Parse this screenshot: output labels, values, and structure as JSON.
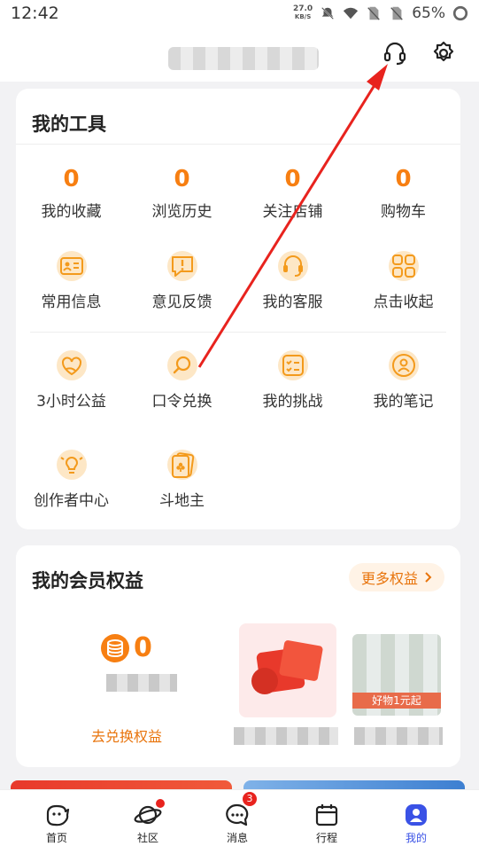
{
  "status_bar": {
    "time": "12:42",
    "net_speed_value": "27.0",
    "net_speed_unit": "KB/S",
    "battery": "65%"
  },
  "header": {
    "icons": [
      "headset-icon",
      "settings-gear-icon"
    ]
  },
  "tools": {
    "title": "我的工具",
    "stats": [
      {
        "value": "0",
        "label": "我的收藏"
      },
      {
        "value": "0",
        "label": "浏览历史"
      },
      {
        "value": "0",
        "label": "关注店铺"
      },
      {
        "value": "0",
        "label": "购物车"
      }
    ],
    "items": [
      {
        "label": "常用信息",
        "icon": "id-card-icon"
      },
      {
        "label": "意见反馈",
        "icon": "feedback-icon"
      },
      {
        "label": "我的客服",
        "icon": "customer-service-icon"
      },
      {
        "label": "点击收起",
        "icon": "grid-icon"
      },
      {
        "label": "3小时公益",
        "icon": "charity-heart-icon"
      },
      {
        "label": "口令兑换",
        "icon": "search-key-icon"
      },
      {
        "label": "我的挑战",
        "icon": "checklist-icon"
      },
      {
        "label": "我的笔记",
        "icon": "user-note-icon"
      },
      {
        "label": "创作者中心",
        "icon": "lightbulb-icon"
      },
      {
        "label": "斗地主",
        "icon": "playing-cards-icon"
      }
    ]
  },
  "member": {
    "title": "我的会员权益",
    "more_label": "更多权益",
    "coin_value": "0",
    "exchange_label": "去兑换权益",
    "promo_badge": "好物1元起"
  },
  "tabs": [
    {
      "label": "首页",
      "icon": "home-pig-icon"
    },
    {
      "label": "社区",
      "icon": "planet-icon"
    },
    {
      "label": "消息",
      "icon": "chat-bubble-icon",
      "badge": "3"
    },
    {
      "label": "行程",
      "icon": "calendar-icon"
    },
    {
      "label": "我的",
      "icon": "profile-icon",
      "active": true
    }
  ],
  "colors": {
    "accent": "#f77f12",
    "active_tab": "#3a52e6",
    "badge": "#e8231e",
    "arrow": "#e8231e"
  }
}
